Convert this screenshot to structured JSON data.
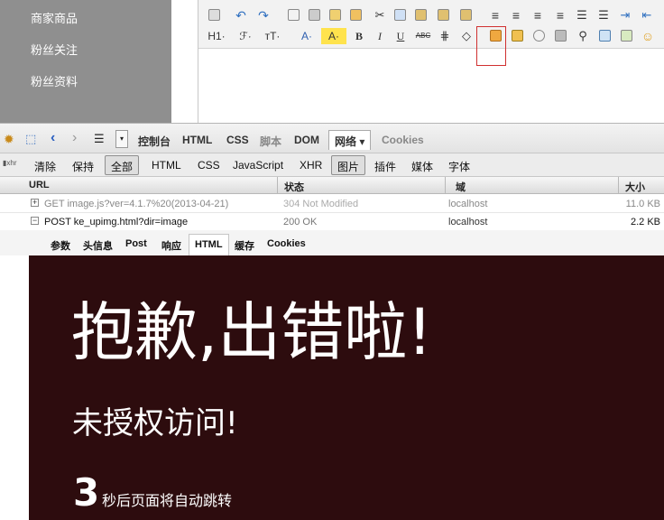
{
  "sidebar": {
    "items": [
      "商家商品",
      "粉丝关注",
      "粉丝资料"
    ]
  },
  "editor": {
    "text_buttons": {
      "heading": "H1·",
      "font_family": "ℱ·",
      "font_size": "тT·",
      "font_color": "A·",
      "highlight": "A·",
      "bold": "B",
      "italic": "I",
      "underline": "U",
      "strikethrough": "ABC"
    }
  },
  "firebug": {
    "tabs": [
      "控制台",
      "HTML",
      "CSS",
      "脚本",
      "DOM",
      "网络 ▾",
      "Cookies"
    ],
    "filters": [
      "清除",
      "保持",
      "全部",
      "HTML",
      "CSS",
      "JavaScript",
      "XHR",
      "图片",
      "插件",
      "媒体",
      "字体"
    ],
    "columns": {
      "url": "URL",
      "status": "状态",
      "domain": "域",
      "size": "大小"
    },
    "requests": [
      {
        "toggle": "+",
        "url": "GET image.js?ver=4.1.7%20(2013-04-21)",
        "status": "304 Not Modified",
        "domain": "localhost",
        "size": "11.0 KB"
      },
      {
        "toggle": "−",
        "url": "POST ke_upimg.html?dir=image",
        "status": "200 OK",
        "domain": "localhost",
        "size": "2.2 KB"
      }
    ],
    "detail_tabs": [
      "参数",
      "头信息",
      "Post",
      "响应",
      "HTML",
      "缓存",
      "Cookies"
    ]
  },
  "preview": {
    "title": "抱歉,出错啦!",
    "subtitle": "未授权访问!",
    "countdown": "3",
    "countdown_text": "秒后页面将自动跳转"
  },
  "colors": {
    "sidebar_bg": "#8f8f8f",
    "preview_bg": "#2d0c0e",
    "highlight": "#d03030"
  }
}
